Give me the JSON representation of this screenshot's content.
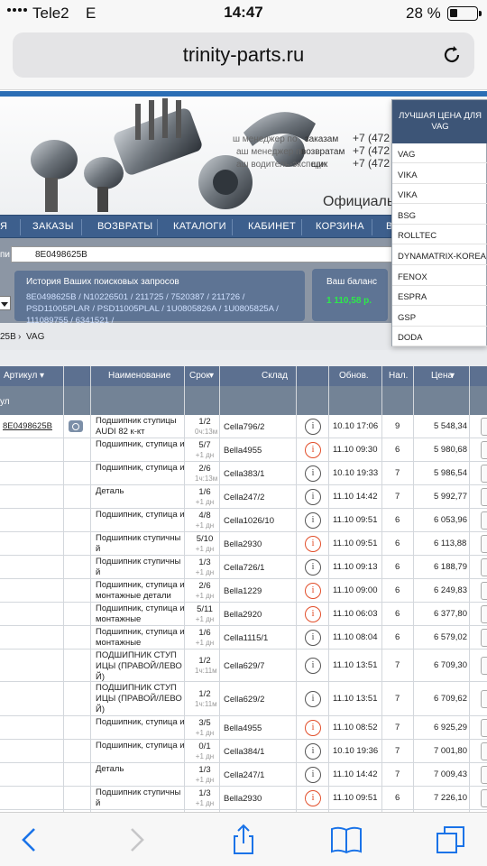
{
  "status": {
    "carrier": "Tele2",
    "network": "E",
    "time": "14:47",
    "battery": "28 %"
  },
  "browser": {
    "url": "trinity-parts.ru"
  },
  "header": {
    "contacts": [
      {
        "label": "заказам",
        "phone": "+7 (472"
      },
      {
        "label": "возвратам",
        "phone": "+7 (472"
      },
      {
        "label": "щик",
        "phone": "+7 (472"
      }
    ],
    "official": "Официальн"
  },
  "nav": [
    "Я",
    "ЗАКАЗЫ",
    "ВОЗВРАТЫ",
    "КАТАЛОГИ",
    "КАБИНЕТ",
    "КОРЗИНА",
    "В"
  ],
  "search": {
    "label": "пи",
    "value": "8E0498625B"
  },
  "history": {
    "title": "История Ваших поисковых запросов",
    "links": "8E0498625B / N10226501 / 211725 / 7520387 / 211726 / PSD11005PLAR / PSD11005PLAL / 1U0805826A / 1U0805825A / 111089755 / 6341521 /"
  },
  "balance": {
    "title": "Ваш баланс",
    "value": "1 110,58 р."
  },
  "breadcrumb": {
    "part": "25B",
    "sep": "›",
    "brand": "VAG"
  },
  "dropdown": {
    "header": "ЛУЧШАЯ ЦЕНА ДЛЯ VAG",
    "items": [
      "VAG",
      "VIKA",
      "VIKA",
      "BSG",
      "ROLLTEC",
      "DYNAMATRIX-KOREA",
      "FENOX",
      "ESPRA",
      "GSP",
      "DODA"
    ]
  },
  "table": {
    "headers": {
      "article": "Артикул",
      "name": "Наименование",
      "term": "Срок",
      "warehouse": "Склад",
      "updated": "Обнов.",
      "avail": "Нал.",
      "price": "Цена"
    },
    "sub_label": "ул",
    "rows": [
      {
        "article": "8E0498625B",
        "name": "Подшипник ступицы AUDI 82 к-кт",
        "term": "1/2",
        "term_sub": "0ч:13м",
        "wh": "Cella796/2",
        "info": "grey",
        "upd": "10.10 17:06",
        "avail": "9",
        "price": "5 548,34",
        "h": 26
      },
      {
        "name": "Подшипник, ступица и",
        "term": "5/7",
        "term_sub": "+1 дн",
        "wh": "Bella4955",
        "info": "red",
        "upd": "11.10 09:30",
        "avail": "6",
        "price": "5 980,68",
        "h": 26
      },
      {
        "name": "Подшипник, ступица и",
        "term": "2/6",
        "term_sub": "1ч:13м",
        "wh": "Cella383/1",
        "info": "grey",
        "upd": "10.10 19:33",
        "avail": "7",
        "price": "5 986,54",
        "h": 26
      },
      {
        "name": "Деталь",
        "term": "1/6",
        "term_sub": "+1 дн",
        "wh": "Cella247/2",
        "info": "grey",
        "upd": "11.10 14:42",
        "avail": "7",
        "price": "5 992,77",
        "h": 26
      },
      {
        "name": "Подшипник, ступица и",
        "term": "4/8",
        "term_sub": "+1 дн",
        "wh": "Cella1026/10",
        "info": "grey",
        "upd": "11.10 09:51",
        "avail": "6",
        "price": "6 053,96",
        "h": 26
      },
      {
        "name": "Подшипник ступичны й",
        "term": "5/10",
        "term_sub": "+1 дн",
        "wh": "Bella2930",
        "info": "red",
        "upd": "11.10 09:51",
        "avail": "6",
        "price": "6 113,88",
        "h": 26
      },
      {
        "name": "Подшипник ступичны й",
        "term": "1/3",
        "term_sub": "+1 дн",
        "wh": "Cella726/1",
        "info": "grey",
        "upd": "11.10 09:13",
        "avail": "6",
        "price": "6 188,79",
        "h": 26
      },
      {
        "name": "Подшипник, ступица и монтажные детали",
        "term": "2/6",
        "term_sub": "+1 дн",
        "wh": "Bella1229",
        "info": "red",
        "upd": "11.10 09:00",
        "avail": "6",
        "price": "6 249,83",
        "h": 26
      },
      {
        "name": "Подшипник, ступица и монтажные",
        "term": "5/11",
        "term_sub": "+1 дн",
        "wh": "Bella2920",
        "info": "red",
        "upd": "11.10 06:03",
        "avail": "6",
        "price": "6 377,80",
        "h": 26
      },
      {
        "name": "Подшипник, ступица и монтажные",
        "term": "1/6",
        "term_sub": "+1 дн",
        "wh": "Cella1115/1",
        "info": "grey",
        "upd": "11.10 08:04",
        "avail": "6",
        "price": "6 579,02",
        "h": 26
      },
      {
        "name": "ПОДШИПНИК СТУП ИЦЫ (ПРАВОЙ/ЛЕВО Й)",
        "term": "1/2",
        "term_sub": "1ч:11м",
        "wh": "Cella629/7",
        "info": "grey",
        "upd": "11.10 13:51",
        "avail": "7",
        "price": "6 709,30",
        "h": 36
      },
      {
        "name": "ПОДШИПНИК СТУП ИЦЫ (ПРАВОЙ/ЛЕВО Й)",
        "term": "1/2",
        "term_sub": "1ч:11м",
        "wh": "Cella629/2",
        "info": "grey",
        "upd": "11.10 13:51",
        "avail": "7",
        "price": "6 709,62",
        "h": 38
      },
      {
        "name": "Подшипник, ступица и",
        "term": "3/5",
        "term_sub": "+1 дн",
        "wh": "Bella4955",
        "info": "red",
        "upd": "11.10 08:52",
        "avail": "7",
        "price": "6 925,29",
        "h": 26
      },
      {
        "name": "Подшипник, ступица и",
        "term": "0/1",
        "term_sub": "+1 дн",
        "wh": "Cella384/1",
        "info": "grey",
        "upd": "10.10 19:36",
        "avail": "7",
        "price": "7 001,80",
        "h": 26
      },
      {
        "name": "Деталь",
        "term": "1/3",
        "term_sub": "+1 дн",
        "wh": "Cella247/1",
        "info": "grey",
        "upd": "11.10 14:42",
        "avail": "7",
        "price": "7 009,43",
        "h": 26
      },
      {
        "name": "Подшипник ступичны й",
        "term": "1/3",
        "term_sub": "+1 дн",
        "wh": "Bella2930",
        "info": "red",
        "upd": "11.10 09:51",
        "avail": "6",
        "price": "7 226,10",
        "h": 26
      }
    ]
  },
  "info_glyph": "i"
}
